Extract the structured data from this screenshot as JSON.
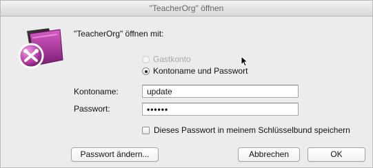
{
  "window": {
    "title": "\"TeacherOrg\" öffnen"
  },
  "dialog": {
    "prompt": "\"TeacherOrg\" öffnen mit:",
    "options": [
      {
        "label": "Gastkonto",
        "enabled": false,
        "selected": false
      },
      {
        "label": "Kontoname und Passwort",
        "enabled": true,
        "selected": true
      }
    ],
    "account": {
      "label": "Kontoname:",
      "value": "update"
    },
    "password": {
      "label": "Passwort:",
      "value": "••••••"
    },
    "keychain": {
      "label": "Dieses Passwort in meinem Schlüsselbund speichern",
      "checked": false
    }
  },
  "buttons": {
    "change_password": "Passwort ändern...",
    "cancel": "Abbrechen",
    "ok": "OK"
  },
  "icons": {
    "app": "filemaker-app-icon",
    "cursor": "mouse-pointer-icon"
  }
}
